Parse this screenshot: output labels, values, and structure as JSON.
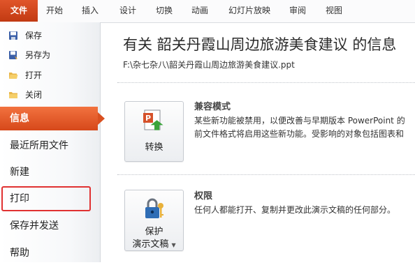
{
  "ribbon": {
    "tabs": [
      "文件",
      "开始",
      "插入",
      "设计",
      "切换",
      "动画",
      "幻灯片放映",
      "审阅",
      "视图"
    ]
  },
  "nav": {
    "commands": [
      {
        "label": "保存",
        "icon": "save-icon"
      },
      {
        "label": "另存为",
        "icon": "save-as-icon"
      },
      {
        "label": "打开",
        "icon": "open-folder-icon"
      },
      {
        "label": "关闭",
        "icon": "close-folder-icon"
      }
    ],
    "items": [
      "信息",
      "最近所用文件",
      "新建",
      "打印",
      "保存并发送",
      "帮助"
    ],
    "selected": "信息"
  },
  "info": {
    "title": "有关 韶关丹霞山周边旅游美食建议 的信息",
    "path": "F:\\杂七杂八\\韶关丹霞山周边旅游美食建议.ppt",
    "compat": {
      "button_label": "转换",
      "heading": "兼容模式",
      "line1": "某些新功能被禁用，以便改善与早期版本 PowerPoint 的",
      "line2": "前文件格式将启用这些新功能。受影响的对象包括图表和"
    },
    "permissions": {
      "button_line1": "保护",
      "button_line2": "演示文稿",
      "heading": "权限",
      "description": "任何人都能打开、复制并更改此演示文稿的任何部分。"
    }
  },
  "colors": {
    "file_tab": "#c83a10",
    "selected_item": "#e35a28",
    "highlight_border": "#e03131"
  }
}
